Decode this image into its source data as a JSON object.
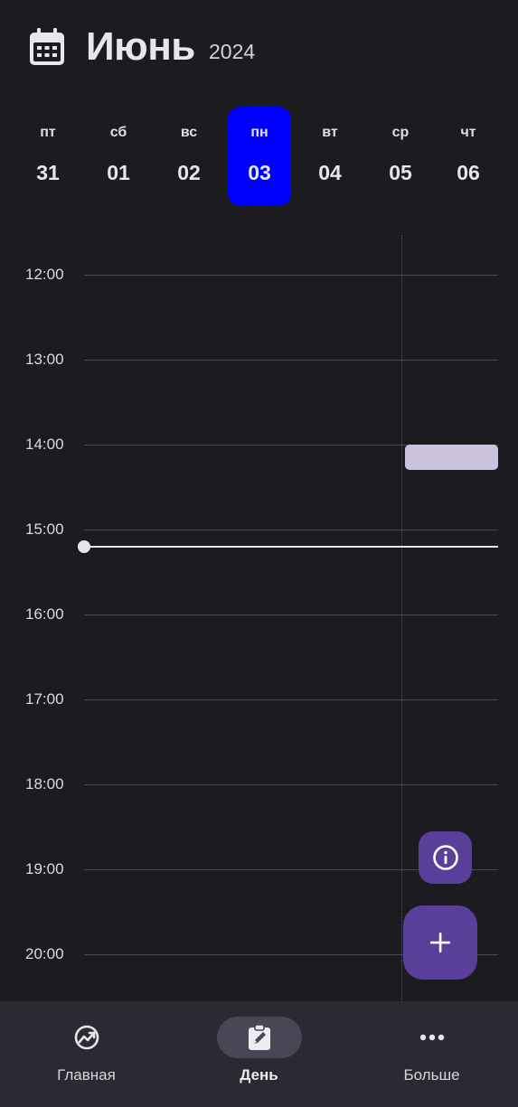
{
  "header": {
    "month": "Июнь",
    "year": "2024",
    "icon": "calendar-icon"
  },
  "week": [
    {
      "dow": "пт",
      "num": "31",
      "selected": false
    },
    {
      "dow": "сб",
      "num": "01",
      "selected": false
    },
    {
      "dow": "вс",
      "num": "02",
      "selected": false
    },
    {
      "dow": "пн",
      "num": "03",
      "selected": true
    },
    {
      "dow": "вт",
      "num": "04",
      "selected": false
    },
    {
      "dow": "ср",
      "num": "05",
      "selected": false
    },
    {
      "dow": "чт",
      "num": "06",
      "selected": false
    }
  ],
  "timeline": {
    "hours": [
      "12:00",
      "13:00",
      "14:00",
      "15:00",
      "16:00",
      "17:00",
      "18:00",
      "19:00",
      "20:00"
    ],
    "event": {
      "start": "14:00",
      "end": "14:18"
    },
    "current_time": "15:12"
  },
  "fabs": {
    "info_icon": "info-icon",
    "add_icon": "plus-icon"
  },
  "bottom_nav": [
    {
      "label": "Главная",
      "icon": "chart-icon",
      "active": false
    },
    {
      "label": "День",
      "icon": "edit-clipboard-icon",
      "active": true
    },
    {
      "label": "Больше",
      "icon": "more-horizontal-icon",
      "active": false
    }
  ],
  "colors": {
    "background": "#1c1b20",
    "selected_day": "#0000ff",
    "fab": "#5a3f9a",
    "event": "#cbc3db",
    "nav_bar": "#2b2932"
  }
}
